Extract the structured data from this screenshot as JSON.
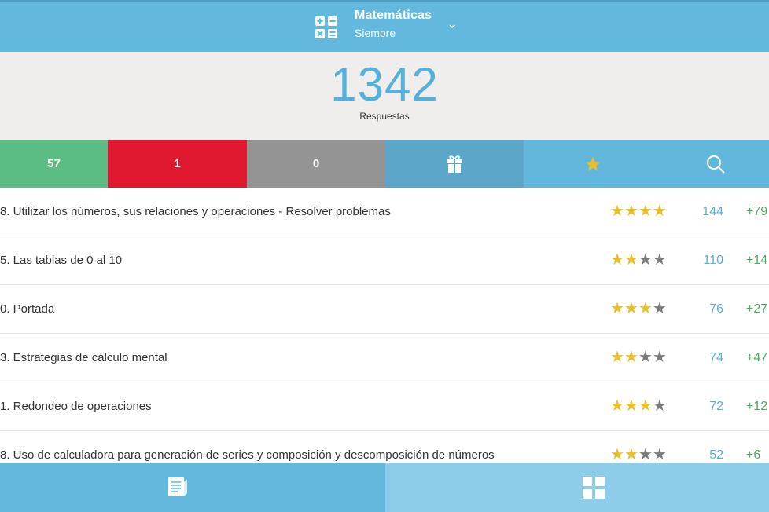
{
  "header": {
    "title": "Matemáticas",
    "subtitle": "Siempre",
    "icon": "calculator-icon",
    "dropdown_icon": "chevron-down-icon",
    "background": "#62b8dd"
  },
  "score": {
    "value": "1342",
    "label": "Respuestas"
  },
  "filters": [
    {
      "name": "correct",
      "label": "57",
      "color": "#5bbd83"
    },
    {
      "name": "wrong",
      "label": "1",
      "color": "#e01931"
    },
    {
      "name": "skipped",
      "label": "0",
      "color": "#949494"
    },
    {
      "name": "gift",
      "icon": "gift-icon",
      "color": "#5ba6c9"
    },
    {
      "name": "favorites",
      "icon": "star-icon",
      "color": "#61b8dc"
    },
    {
      "name": "search",
      "icon": "search-icon",
      "color": "#61b8dc"
    }
  ],
  "topics": [
    {
      "label": "8. Utilizar los números, sus relaciones y operaciones - Resolver problemas",
      "stars": 4,
      "count": "144",
      "delta": "+79"
    },
    {
      "label": "5. Las tablas de 0 al 10",
      "stars": 2,
      "count": "110",
      "delta": "+14"
    },
    {
      "label": "0. Portada",
      "stars": 3,
      "count": "76",
      "delta": "+27"
    },
    {
      "label": "3. Estrategias de cálculo mental",
      "stars": 2,
      "count": "74",
      "delta": "+47"
    },
    {
      "label": "1. Redondeo de operaciones",
      "stars": 3,
      "count": "72",
      "delta": "+12"
    },
    {
      "label": "8. Uso de calculadora para generación de series y composición y descomposición de números",
      "stars": 2,
      "count": "52",
      "delta": "+6"
    }
  ],
  "star_colors": {
    "on": "#e8c02a",
    "off": "#7b7b7b"
  },
  "bottom_tabs": [
    {
      "name": "notes",
      "icon": "notebook-icon",
      "active": true
    },
    {
      "name": "grid",
      "icon": "grid-icon",
      "active": false
    }
  ]
}
